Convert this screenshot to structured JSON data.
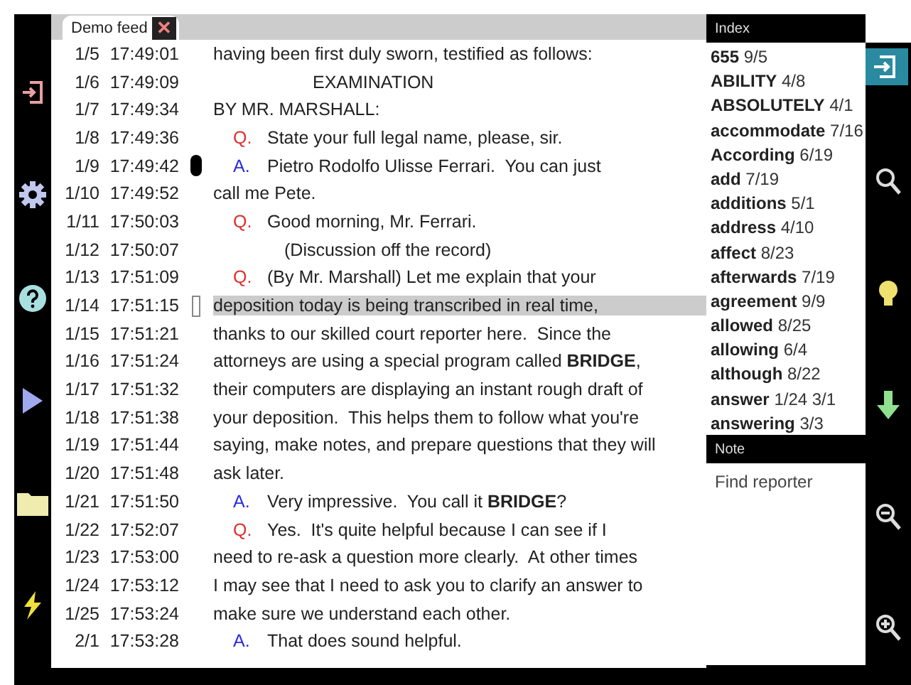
{
  "tab": {
    "label": "Demo feed",
    "close": "✕"
  },
  "lines": [
    {
      "ref": "1/5",
      "time": "17:49:01",
      "kind": "plain",
      "text": "having been first duly sworn, testified as follows:",
      "highlighted": false
    },
    {
      "ref": "1/6",
      "time": "17:49:09",
      "kind": "center",
      "text": "EXAMINATION",
      "highlighted": false
    },
    {
      "ref": "1/7",
      "time": "17:49:34",
      "kind": "plain",
      "text": "BY MR. MARSHALL:",
      "highlighted": false
    },
    {
      "ref": "1/8",
      "time": "17:49:36",
      "kind": "q",
      "speaker": "Q.",
      "text": "State your full legal name, please, sir.",
      "highlighted": false
    },
    {
      "ref": "1/9",
      "time": "17:49:42",
      "kind": "a",
      "speaker": "A.",
      "text": "Pietro Rodolfo Ulisse Ferrari.  You can just",
      "marker": {
        "kind": "pill"
      },
      "highlighted": false
    },
    {
      "ref": "1/10",
      "time": "17:49:52",
      "kind": "plain",
      "text": "call me Pete.",
      "highlighted": false
    },
    {
      "ref": "1/11",
      "time": "17:50:03",
      "kind": "q",
      "speaker": "Q.",
      "text": "Good morning, Mr. Ferrari.",
      "highlighted": false
    },
    {
      "ref": "1/12",
      "time": "17:50:07",
      "kind": "paren",
      "text": "(Discussion off the record)",
      "highlighted": false
    },
    {
      "ref": "1/13",
      "time": "17:51:09",
      "kind": "q",
      "speaker": "Q.",
      "text": "(By Mr. Marshall) Let me explain that your",
      "highlighted": false
    },
    {
      "ref": "1/14",
      "time": "17:51:15",
      "kind": "plain",
      "text": "deposition today is being transcribed in real time,",
      "marker": {
        "kind": "bar"
      },
      "highlighted": true
    },
    {
      "ref": "1/15",
      "time": "17:51:21",
      "kind": "plain",
      "text": "thanks to our skilled court reporter here.  Since the",
      "highlighted": false
    },
    {
      "ref": "1/16",
      "time": "17:51:24",
      "kind": "plain",
      "text": "attorneys are using a special program called **BRIDGE**,",
      "highlighted": false
    },
    {
      "ref": "1/17",
      "time": "17:51:32",
      "kind": "plain",
      "text": "their computers are displaying an instant rough draft of",
      "highlighted": false
    },
    {
      "ref": "1/18",
      "time": "17:51:38",
      "kind": "plain",
      "text": "your deposition.  This helps them to follow what you're",
      "highlighted": false
    },
    {
      "ref": "1/19",
      "time": "17:51:44",
      "kind": "plain",
      "text": "saying, make notes, and prepare questions that they will",
      "highlighted": false
    },
    {
      "ref": "1/20",
      "time": "17:51:48",
      "kind": "plain",
      "text": "ask later.",
      "highlighted": false
    },
    {
      "ref": "1/21",
      "time": "17:51:50",
      "kind": "a",
      "speaker": "A.",
      "text": "Very impressive.  You call it **BRIDGE**?",
      "highlighted": false
    },
    {
      "ref": "1/22",
      "time": "17:52:07",
      "kind": "q",
      "speaker": "Q.",
      "text": "Yes.  It's quite helpful because I can see if I",
      "highlighted": false
    },
    {
      "ref": "1/23",
      "time": "17:53:00",
      "kind": "plain",
      "text": "need to re-ask a question more clearly.  At other times",
      "highlighted": false
    },
    {
      "ref": "1/24",
      "time": "17:53:12",
      "kind": "plain",
      "text": "I may see that I need to ask you to clarify an answer to",
      "highlighted": false
    },
    {
      "ref": "1/25",
      "time": "17:53:24",
      "kind": "plain",
      "text": "make sure we understand each other.",
      "highlighted": false
    },
    {
      "ref": "2/1",
      "time": "17:53:28",
      "kind": "a",
      "speaker": "A.",
      "text": "That does sound helpful.",
      "highlighted": false
    }
  ],
  "index": {
    "title": "Index",
    "entries": [
      {
        "term": "655",
        "refs": "9/5"
      },
      {
        "term": "ABILITY",
        "refs": "4/8"
      },
      {
        "term": "ABSOLUTELY",
        "refs": "4/1"
      },
      {
        "term": "accommodate",
        "refs": "7/16"
      },
      {
        "term": "According",
        "refs": "6/19"
      },
      {
        "term": "add",
        "refs": "7/19"
      },
      {
        "term": "additions",
        "refs": "5/1"
      },
      {
        "term": "address",
        "refs": "4/10"
      },
      {
        "term": "affect",
        "refs": "8/23"
      },
      {
        "term": "afterwards",
        "refs": "7/19"
      },
      {
        "term": "agreement",
        "refs": "9/9"
      },
      {
        "term": "allowed",
        "refs": "8/25"
      },
      {
        "term": "allowing",
        "refs": "6/4"
      },
      {
        "term": "although",
        "refs": "8/22"
      },
      {
        "term": "answer",
        "refs": "1/24 3/1"
      },
      {
        "term": "answering",
        "refs": "3/3"
      }
    ]
  },
  "note": {
    "title": "Note",
    "text": "Find reporter"
  }
}
